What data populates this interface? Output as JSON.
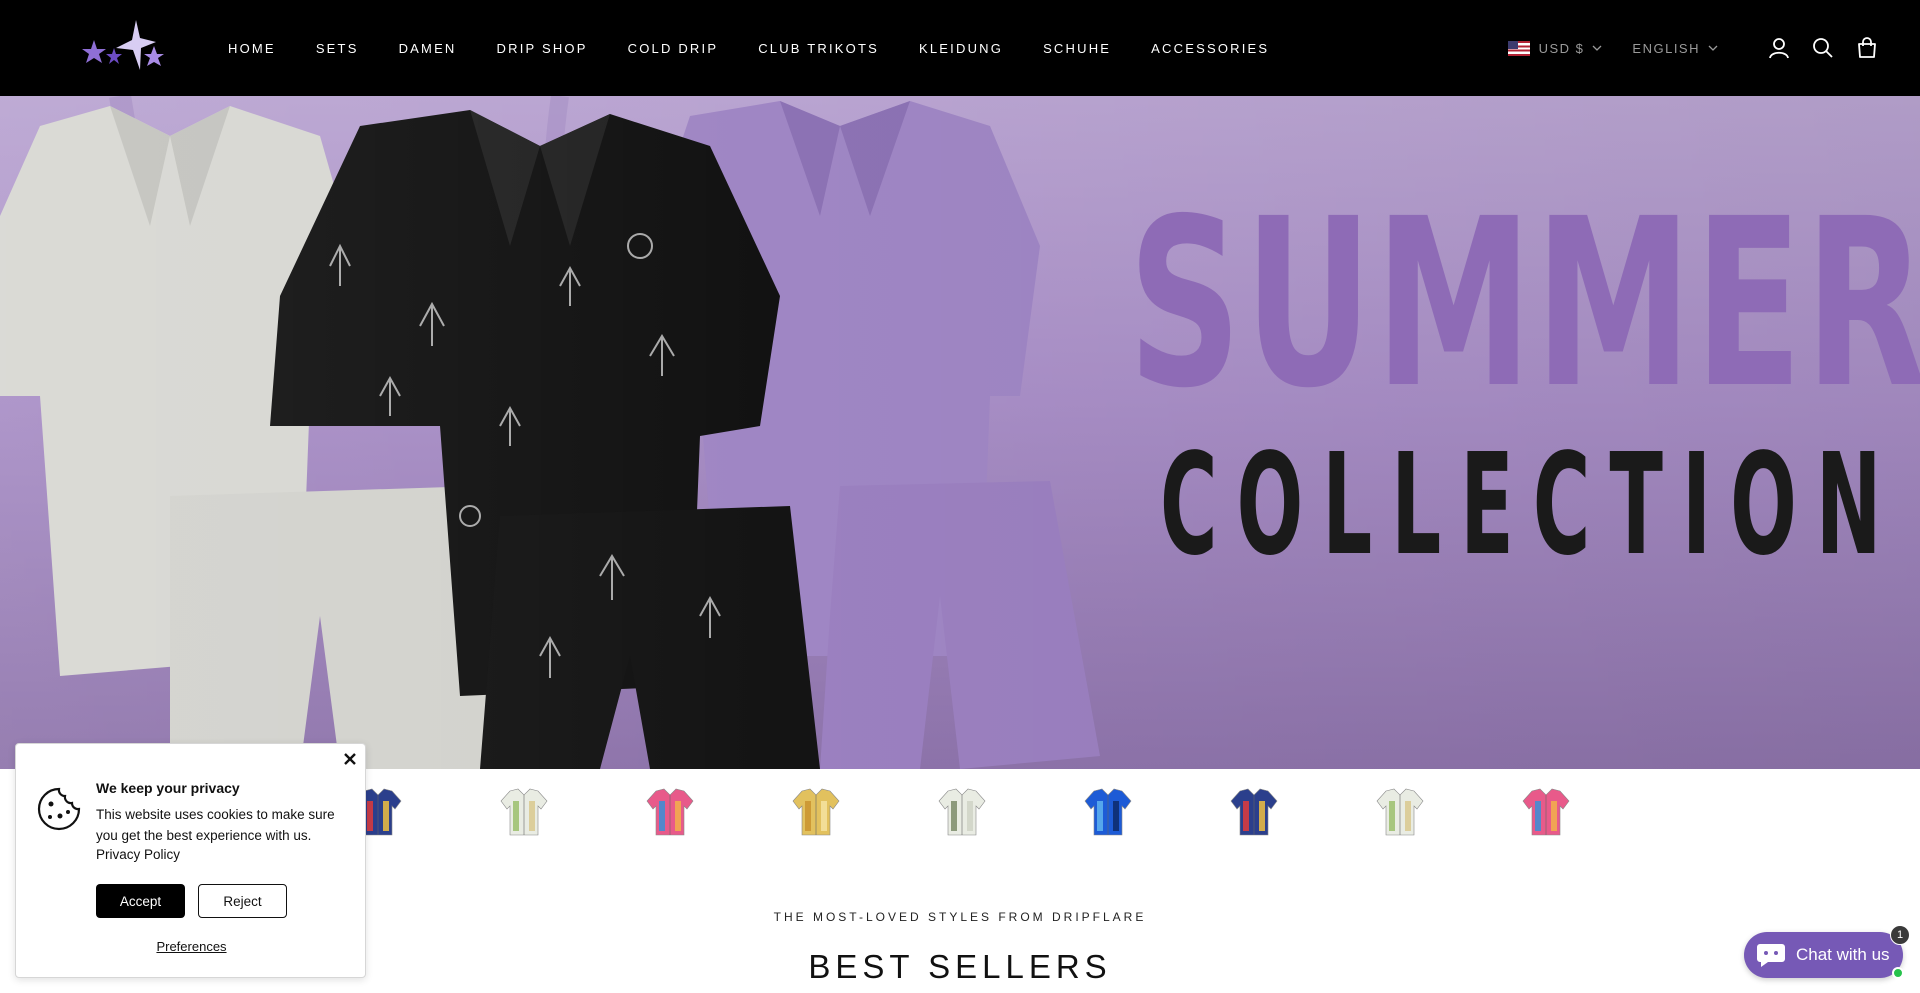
{
  "header": {
    "logo_alt": "Dripflare",
    "nav": [
      {
        "label": "HOME"
      },
      {
        "label": "SETS"
      },
      {
        "label": "DAMEN"
      },
      {
        "label": "DRIP SHOP"
      },
      {
        "label": "COLD DRIP"
      },
      {
        "label": "CLUB TRIKOTS"
      },
      {
        "label": "KLEIDUNG"
      },
      {
        "label": "SCHUHE"
      },
      {
        "label": "ACCESSORIES"
      }
    ],
    "currency": "USD $",
    "language": "ENGLISH",
    "icons": [
      "account-icon",
      "search-icon",
      "cart-icon"
    ]
  },
  "hero": {
    "title_line1": "SUMMER",
    "title_line2": "COLLECTION"
  },
  "thumbnails": [
    {
      "name": "tropical-blue-shirt",
      "colors": [
        "#2b3f8c",
        "#e23b3b",
        "#f0c040"
      ]
    },
    {
      "name": "white-print-shirt",
      "colors": [
        "#e9ece3",
        "#9bbf6c",
        "#d9c98e"
      ]
    },
    {
      "name": "pink-stripe-shirt",
      "colors": [
        "#e85a8a",
        "#3a8fd6",
        "#f2b04a"
      ]
    },
    {
      "name": "yellow-pattern-shirt",
      "colors": [
        "#e2c15e",
        "#c9932f",
        "#f5e3a1"
      ]
    },
    {
      "name": "white-green-shirt",
      "colors": [
        "#e9ece3",
        "#7c8c6a",
        "#cfd4c6"
      ]
    },
    {
      "name": "blue-gradient-shirt",
      "colors": [
        "#1d5bd6",
        "#5fb4f0",
        "#0d2a6a"
      ]
    },
    {
      "name": "tropical-blue-shirt-2",
      "colors": [
        "#2b3f8c",
        "#e23b3b",
        "#f0c040"
      ]
    },
    {
      "name": "white-print-shirt-2",
      "colors": [
        "#e9ece3",
        "#9bbf6c",
        "#d9c98e"
      ]
    },
    {
      "name": "pink-stripe-shirt-2",
      "colors": [
        "#e85a8a",
        "#3a8fd6",
        "#f2b04a"
      ]
    }
  ],
  "best_sellers": {
    "subheading": "THE MOST-LOVED STYLES FROM DRIPFLARE",
    "heading": "BEST SELLERS"
  },
  "cookie": {
    "title": "We keep your privacy",
    "text": "This website uses cookies to make sure you get the best experience with us.",
    "policy_link": "Privacy Policy",
    "accept": "Accept",
    "reject": "Reject",
    "preferences": "Preferences"
  },
  "chat": {
    "label": "Chat with us",
    "badge": "1"
  }
}
